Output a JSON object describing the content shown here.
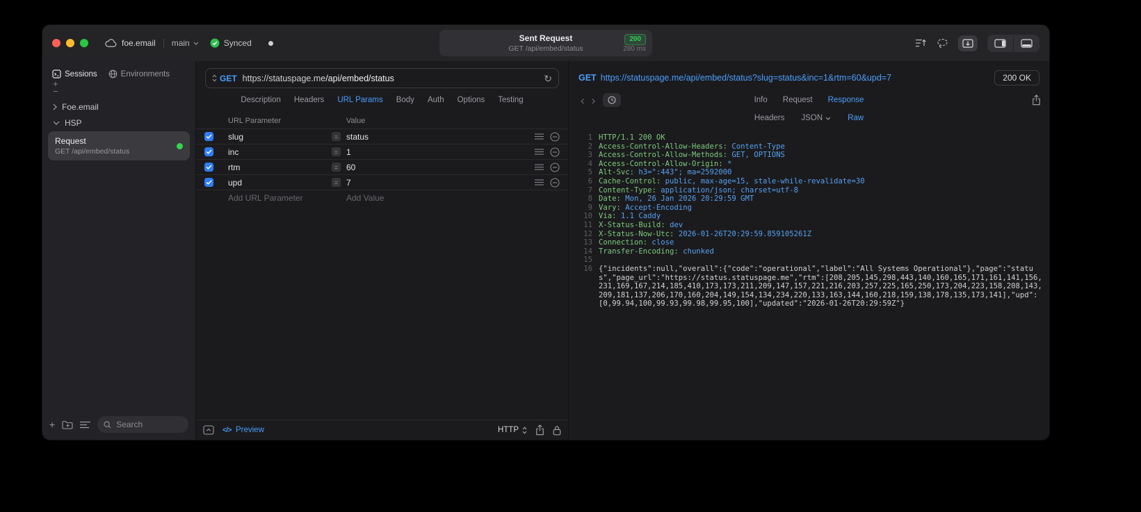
{
  "icons": {
    "plus": "+",
    "minus": "−",
    "equals": "=",
    "back": "‹",
    "forward": "›",
    "refresh": "↻",
    "code_glyph": "</>"
  },
  "titlebar": {
    "project": "foe.email",
    "branch": "main",
    "sync_label": "Synced",
    "center": {
      "title": "Sent Request",
      "status": "200",
      "subtitle": "GET /api/embed/status",
      "duration": "280 ms"
    }
  },
  "sidebar": {
    "tabs": {
      "sessions": "Sessions",
      "environments": "Environments"
    },
    "tree": {
      "group1": "Foe.email",
      "group2": "HSP"
    },
    "request_item": {
      "title": "Request",
      "subtitle": "GET /api/embed/status"
    },
    "search_placeholder": "Search"
  },
  "request_pane": {
    "method": "GET",
    "url_base": "https://statuspage.me",
    "url_path": "/api/embed/status",
    "tabs": [
      "Description",
      "Headers",
      "URL Params",
      "Body",
      "Auth",
      "Options",
      "Testing"
    ],
    "active_tab": "URL Params",
    "param_table": {
      "columns": [
        "URL Parameter",
        "Value"
      ],
      "rows": [
        {
          "name": "slug",
          "value": "status",
          "enabled": true
        },
        {
          "name": "inc",
          "value": "1",
          "enabled": true
        },
        {
          "name": "rtm",
          "value": "60",
          "enabled": true
        },
        {
          "name": "upd",
          "value": "7",
          "enabled": true
        }
      ],
      "add_parameter_label": "Add URL Parameter",
      "add_value_label": "Add Value"
    },
    "footer": {
      "preview_label": "Preview",
      "protocol": "HTTP"
    }
  },
  "response_pane": {
    "request_line": {
      "method": "GET",
      "url": "https://statuspage.me/api/embed/status?slug=status&inc=1&rtm=60&upd=7"
    },
    "status": "200 OK",
    "tabs": [
      "Info",
      "Request",
      "Response"
    ],
    "active_tab": "Response",
    "view_tabs": [
      "Headers",
      "JSON",
      "Raw"
    ],
    "active_view_tab": "Raw",
    "lines": [
      {
        "n": "1",
        "parts": [
          {
            "t": "HTTP/1.1 200 OK",
            "c": "g"
          }
        ]
      },
      {
        "n": "2",
        "parts": [
          {
            "t": "Access-Control-Allow-Headers: ",
            "c": "g"
          },
          {
            "t": "Content-Type",
            "c": "b"
          }
        ]
      },
      {
        "n": "3",
        "parts": [
          {
            "t": "Access-Control-Allow-Methods: ",
            "c": "g"
          },
          {
            "t": "GET, OPTIONS",
            "c": "b"
          }
        ]
      },
      {
        "n": "4",
        "parts": [
          {
            "t": "Access-Control-Allow-Origin: ",
            "c": "g"
          },
          {
            "t": "*",
            "c": "b"
          }
        ]
      },
      {
        "n": "5",
        "parts": [
          {
            "t": "Alt-Svc: ",
            "c": "g"
          },
          {
            "t": "h3=\":443\"; ma=2592000",
            "c": "b"
          }
        ]
      },
      {
        "n": "6",
        "parts": [
          {
            "t": "Cache-Control: ",
            "c": "g"
          },
          {
            "t": "public, max-age=15, stale-while-revalidate=30",
            "c": "b"
          }
        ]
      },
      {
        "n": "7",
        "parts": [
          {
            "t": "Content-Type: ",
            "c": "g"
          },
          {
            "t": "application/json; charset=utf-8",
            "c": "b"
          }
        ]
      },
      {
        "n": "8",
        "parts": [
          {
            "t": "Date: ",
            "c": "g"
          },
          {
            "t": "Mon, 26 Jan 2026 20:29:59 GMT",
            "c": "b"
          }
        ]
      },
      {
        "n": "9",
        "parts": [
          {
            "t": "Vary: ",
            "c": "g"
          },
          {
            "t": "Accept-Encoding",
            "c": "b"
          }
        ]
      },
      {
        "n": "10",
        "parts": [
          {
            "t": "Via: ",
            "c": "g"
          },
          {
            "t": "1.1 Caddy",
            "c": "b"
          }
        ]
      },
      {
        "n": "11",
        "parts": [
          {
            "t": "X-Status-Build: ",
            "c": "g"
          },
          {
            "t": "dev",
            "c": "b"
          }
        ]
      },
      {
        "n": "12",
        "parts": [
          {
            "t": "X-Status-Now-Utc: ",
            "c": "g"
          },
          {
            "t": "2026-01-26T20:29:59.859105261Z",
            "c": "b"
          }
        ]
      },
      {
        "n": "13",
        "parts": [
          {
            "t": "Connection: ",
            "c": "g"
          },
          {
            "t": "close",
            "c": "b"
          }
        ]
      },
      {
        "n": "14",
        "parts": [
          {
            "t": "Transfer-Encoding: ",
            "c": "g"
          },
          {
            "t": "chunked",
            "c": "b"
          }
        ]
      },
      {
        "n": "15",
        "parts": []
      },
      {
        "n": "16",
        "parts": [
          {
            "t": "{\"incidents\":null,\"overall\":{\"code\":\"operational\",\"label\":\"All Systems Operational\"},\"page\":\"status\",\"page_url\":\"https://status.statuspage.me\",\"rtm\":[208,205,145,298,443,140,160,165,171,161,141,156,231,169,167,214,185,410,173,173,211,209,147,157,221,216,203,257,225,165,250,173,204,223,158,208,143,209,181,137,206,170,160,204,149,154,134,234,220,133,163,144,160,218,159,138,178,135,173,141],\"upd\":[0,99.94,100,99.93,99.98,99.95,100],\"updated\":\"2026-01-26T20:29:59Z\"}",
            "c": "w"
          }
        ]
      }
    ]
  },
  "colors": {
    "accent": "#4b9ef9",
    "success": "#30d158",
    "checkbox": "#2f7cf6",
    "header_key": "#7ec97c",
    "header_value": "#56a0ee"
  }
}
